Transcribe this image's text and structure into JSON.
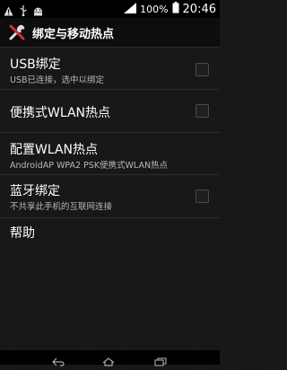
{
  "status": {
    "battery_percent": "100%",
    "time": "20:46"
  },
  "header": {
    "title": "绑定与移动热点",
    "icon": "tools-icon"
  },
  "settings": {
    "items": [
      {
        "title": "USB绑定",
        "subtitle": "USB已连接，选中以绑定",
        "checked": false
      },
      {
        "title": "便携式WLAN热点",
        "subtitle": "",
        "checked": false
      },
      {
        "title": "配置WLAN热点",
        "subtitle": "AndroidAP WPA2 PSK便携式WLAN热点"
      },
      {
        "title": "蓝牙绑定",
        "subtitle": "不共享此手机的互联网连接",
        "checked": false
      },
      {
        "title": "帮助",
        "subtitle": ""
      }
    ]
  },
  "nav": {
    "buttons": [
      "back-icon",
      "home-icon",
      "recent-apps-icon"
    ]
  }
}
